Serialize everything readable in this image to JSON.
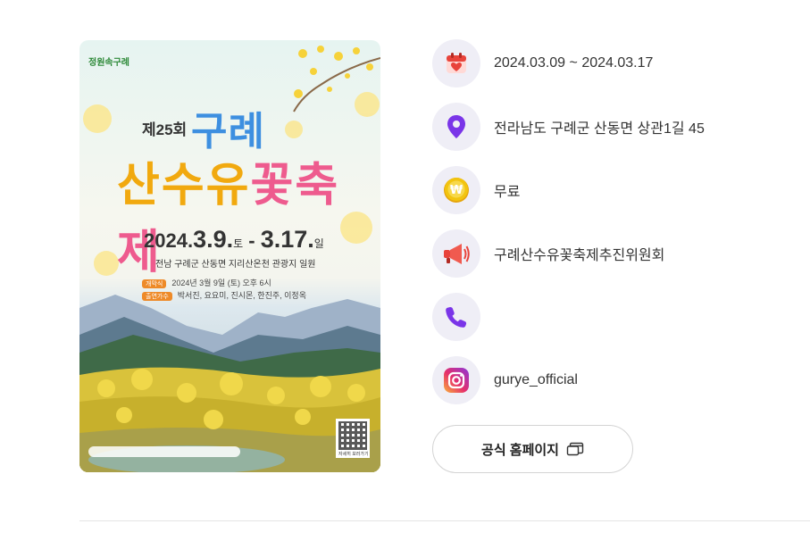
{
  "poster": {
    "logo": "정원속구례",
    "edition": "제25회",
    "title_line1": "구례",
    "title_line2_a": "산수유",
    "title_line2_b": "꽃축제",
    "date_year": "2024.",
    "date_start": "3.9.",
    "date_start_day": "토",
    "date_sep": " - ",
    "date_end": "3.17.",
    "date_end_day": "일",
    "venue": "전남 구례군 산동면 지리산온천 관광지 일원",
    "rows": [
      {
        "tag": "개막식",
        "text": "2024년 3월 9일 (토) 오후 6시"
      },
      {
        "tag": "출연가수",
        "text": "박서진, 요요미, 진시몬, 한진주, 이정옥"
      }
    ],
    "qr_label": "자세히 보러가기"
  },
  "info": {
    "period": "2024.03.09 ~ 2024.03.17",
    "address": "전라남도 구례군 산동면 상관1길 45",
    "fee": "무료",
    "organizer": "구례산수유꽃축제추진위원회",
    "phone": "",
    "instagram": "gurye_official"
  },
  "homepage_button": "공식 홈페이지",
  "icons": {
    "calendar": "calendar-icon",
    "location": "location-pin-icon",
    "fee": "won-coin-icon",
    "organizer": "megaphone-icon",
    "phone": "phone-icon",
    "instagram": "instagram-icon",
    "external": "external-window-icon"
  },
  "colors": {
    "icon_bg": "#efeef6",
    "accent_purple": "#7a35e8",
    "calendar_red": "#e8433b",
    "coin_yellow": "#f2c40f"
  }
}
